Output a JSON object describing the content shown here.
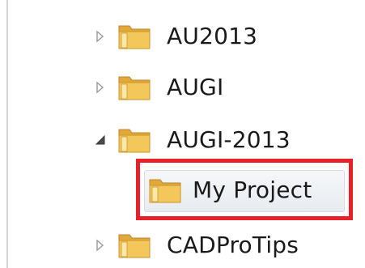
{
  "tree": {
    "items": [
      {
        "label": "AU2013",
        "expander": "collapsed",
        "icon": "folder-icon"
      },
      {
        "label": "AUGI",
        "expander": "collapsed",
        "icon": "folder-icon"
      },
      {
        "label": "AUGI-2013",
        "expander": "expanded",
        "icon": "folder-icon"
      },
      {
        "label": "My Project",
        "expander": "none",
        "icon": "folder-icon",
        "selected": true,
        "highlighted": true
      },
      {
        "label": "CADProTips",
        "expander": "collapsed",
        "icon": "folder-icon"
      }
    ]
  },
  "colors": {
    "highlight": "#e8202a",
    "folder_body": "#f3c75a",
    "folder_back": "#e2a93a",
    "text": "#1a1a1a"
  }
}
